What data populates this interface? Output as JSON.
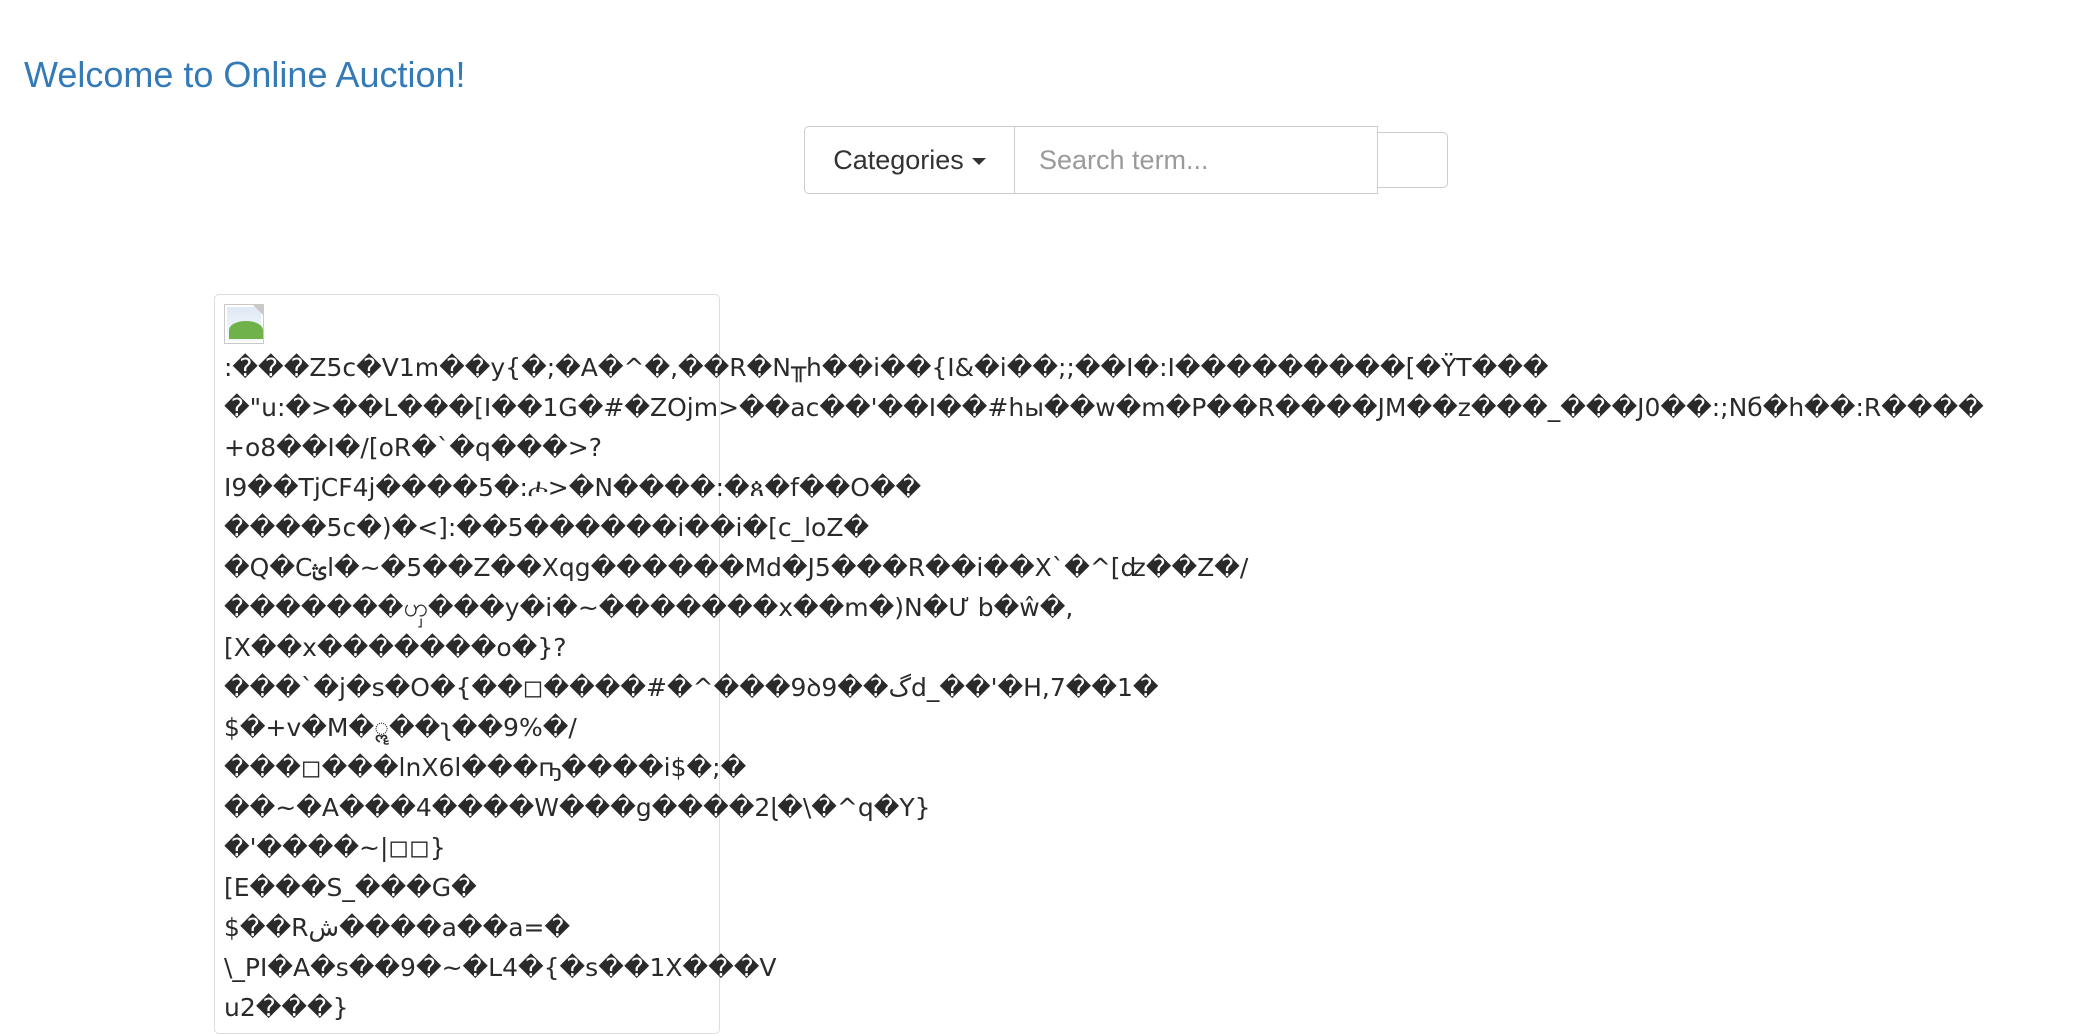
{
  "header": {
    "brand": "Welcome to Online Auction!"
  },
  "search": {
    "categories_label": "Categories",
    "placeholder": "Search term...",
    "button_label": ""
  },
  "item": {
    "image_alt": "",
    "description_lines": [
      ":���Z5c�V1m��y{�;�A�^�,��R�N╥h��i��{I&�i��;;��I�:I���������[�ŸT���",
      "�\"u:�>��L���[I��1G�#�ZOjm>��ac��'��I��#hы��w�m�P��R����JM��z���_���J0��:;Nб�h��:R����",
      "+o8��I�/[oR�`�q���>?",
      "I9��TjCF4j����5�:ሖ>�N����:�ጰ�f��O��",
      "����5c�)�<]:��5������i��i�[c_loZ�",
      "�Q�Cؿl�~�5��Z��Xqg������Md�J5���R��i��X`�^[ʣ��Z�/",
      "�������ၯ���y�i�~�������x��m�)N�Ư b�ŵ�,",
      "[X��x�������o�}?",
      "���`�j�s�O�{��◻����#�^���9ꝺ9��گd_��'�H,7��1�",
      "$�+v�M�ॣ��ʅ��9%�/",
      "���◻���lnX6l���ҧ����i$�;�",
      "��~�A���4����W���g����2ɭ�\\�^q�Y}",
      "�'����~|◻◻}",
      "[E���S_���G�",
      "$��Rش����a��a=�",
      "\\_PI�A�s��9�~�L4�{�s��1X���V",
      "u2���}"
    ]
  }
}
